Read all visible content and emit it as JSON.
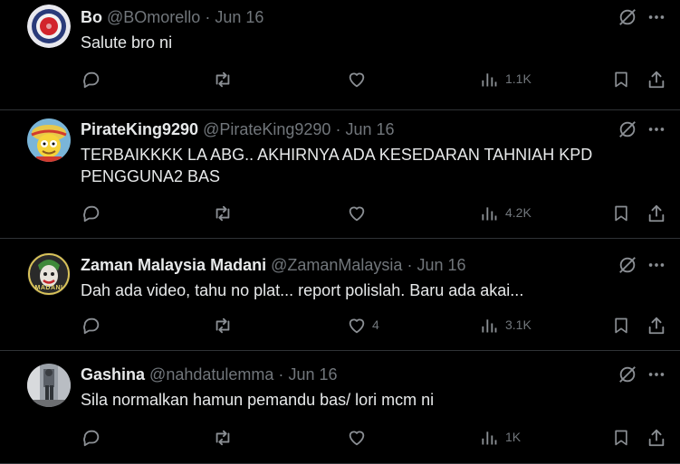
{
  "tweets": [
    {
      "name": "Bo",
      "handle": "@BOmorello",
      "dot": "·",
      "date": "Jun 16",
      "text": "Salute bro ni",
      "likes": "",
      "views": "1.1K",
      "avatar": "mod-target-avatar"
    },
    {
      "name": "PirateKing9290",
      "handle": "@PirateKing9290",
      "dot": "·",
      "date": "Jun 16",
      "text": "TERBAIKKKK LA ABG.. AKHIRNYA ADA KESEDARAN TAHNIAH KPD PENGGUNA2 BAS",
      "likes": "",
      "views": "4.2K",
      "avatar": "cartoon-pirate-avatar"
    },
    {
      "name": "Zaman Malaysia Madani",
      "handle": "@ZamanMalaysia",
      "dot": "·",
      "date": "Jun 16",
      "text": "Dah ada video, tahu no plat... report polislah. Baru ada akai...",
      "likes": "4",
      "views": "3.1K",
      "avatar": "madani-joker-avatar",
      "avatar_label": "MADANI"
    },
    {
      "name": "Gashina",
      "handle": "@nahdatulemma",
      "dot": "·",
      "date": "Jun 16",
      "text": "Sila normalkan hamun pemandu bas/ lori mcm ni",
      "likes": "",
      "views": "1K",
      "avatar": "street-photo-avatar"
    }
  ],
  "colors": {
    "background": "#000000",
    "text": "#e7e9ea",
    "muted": "#71767b",
    "divider": "#2f3336"
  },
  "icons": [
    "reply-icon",
    "retweet-icon",
    "like-icon",
    "views-icon",
    "bookmark-icon",
    "share-icon",
    "grok-icon",
    "more-icon"
  ]
}
